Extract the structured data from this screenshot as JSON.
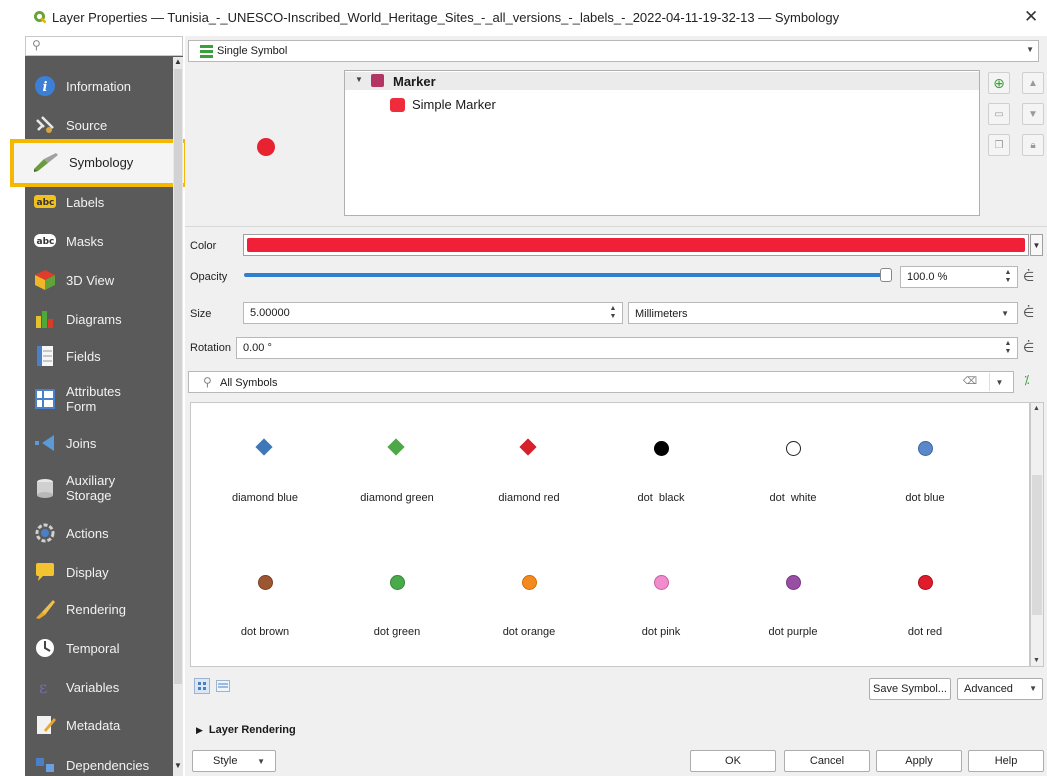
{
  "window": {
    "title": "Layer Properties — Tunisia_-_UNESCO-Inscribed_World_Heritage_Sites_-_all_versions_-_labels_-_2022-04-11-19-32-13 — Symbology",
    "close_glyph": "✕"
  },
  "sidebar": {
    "search_icon": "search-icon",
    "active": "Symbology",
    "items": [
      {
        "label": "Information",
        "icon": "info-icon"
      },
      {
        "label": "Source",
        "icon": "source-icon"
      },
      {
        "label": "Symbology",
        "icon": "paintbrush-icon"
      },
      {
        "label": "Labels",
        "icon": "labels-icon"
      },
      {
        "label": "Masks",
        "icon": "masks-icon"
      },
      {
        "label": "3D View",
        "icon": "cube-icon"
      },
      {
        "label": "Diagrams",
        "icon": "diagrams-icon"
      },
      {
        "label": "Fields",
        "icon": "fields-icon"
      },
      {
        "label": "Attributes\nForm",
        "icon": "form-icon"
      },
      {
        "label": "Joins",
        "icon": "joins-icon"
      },
      {
        "label": "Auxiliary\nStorage",
        "icon": "storage-icon"
      },
      {
        "label": "Actions",
        "icon": "actions-icon"
      },
      {
        "label": "Display",
        "icon": "display-icon"
      },
      {
        "label": "Rendering",
        "icon": "rendering-icon"
      },
      {
        "label": "Temporal",
        "icon": "clock-icon"
      },
      {
        "label": "Variables",
        "icon": "variables-icon"
      },
      {
        "label": "Metadata",
        "icon": "metadata-icon"
      },
      {
        "label": "Dependencies",
        "icon": "dependencies-icon"
      }
    ],
    "labels_badge": "abc",
    "masks_badge": "abc"
  },
  "renderer": {
    "label": "Single Symbol"
  },
  "symbol_tree": {
    "root": "Marker",
    "child": "Simple Marker"
  },
  "properties": {
    "color_label": "Color",
    "color_value": "#ef2038",
    "opacity_label": "Opacity",
    "opacity_value": "100.0 %",
    "opacity_fraction": 1.0,
    "size_label": "Size",
    "size_value": "5.00000",
    "unit_value": "Millimeters",
    "rotation_label": "Rotation",
    "rotation_value": "0.00 °"
  },
  "library": {
    "search_value": "All Symbols",
    "symbols": [
      {
        "name": "diamond blue",
        "shape": "diamond",
        "color": "#3f78b8",
        "border": "#3f78b8"
      },
      {
        "name": "diamond green",
        "shape": "diamond",
        "color": "#4ea84a",
        "border": "#4ea84a"
      },
      {
        "name": "diamond red",
        "shape": "diamond",
        "color": "#d81f2c",
        "border": "#d81f2c"
      },
      {
        "name": "dot  black",
        "shape": "circle",
        "color": "#000000",
        "border": "#000000"
      },
      {
        "name": "dot  white",
        "shape": "circle",
        "color": "#ffffff",
        "border": "#222222"
      },
      {
        "name": "dot blue",
        "shape": "circle",
        "color": "#5b88c9",
        "border": "#3a66a6"
      },
      {
        "name": "dot brown",
        "shape": "circle",
        "color": "#9c5632",
        "border": "#7a3f22"
      },
      {
        "name": "dot green",
        "shape": "circle",
        "color": "#4aaa4a",
        "border": "#2f8a33"
      },
      {
        "name": "dot orange",
        "shape": "circle",
        "color": "#f48a1e",
        "border": "#d46c08"
      },
      {
        "name": "dot pink",
        "shape": "circle",
        "color": "#f28ccd",
        "border": "#c85fa6"
      },
      {
        "name": "dot purple",
        "shape": "circle",
        "color": "#984ea3",
        "border": "#7b3487"
      },
      {
        "name": "dot red",
        "shape": "circle",
        "color": "#e01c2c",
        "border": "#b00a18"
      }
    ]
  },
  "buttons": {
    "save_symbol": "Save Symbol...",
    "advanced": "Advanced",
    "layer_rendering": "Layer Rendering",
    "style": "Style",
    "ok": "OK",
    "cancel": "Cancel",
    "apply": "Apply",
    "help": "Help"
  },
  "accent": {
    "highlight": "#f5b800",
    "arrow": "#f5b800"
  }
}
